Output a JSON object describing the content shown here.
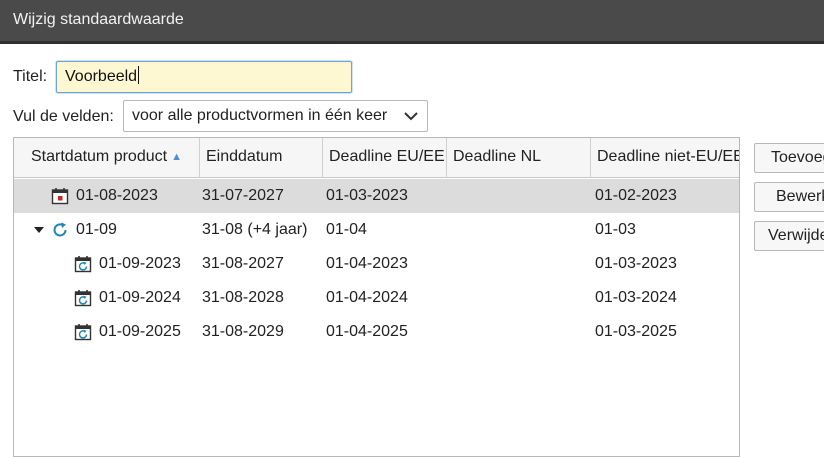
{
  "window": {
    "title": "Wijzig standaardwaarde"
  },
  "form": {
    "title_label": "Titel:",
    "title_value": "Voorbeeld",
    "fill_label": "Vul de velden:",
    "fill_value": "voor alle productvormen in één keer"
  },
  "table": {
    "columns": [
      "Startdatum product",
      "Einddatum",
      "Deadline EU/EE",
      "Deadline NL",
      "Deadline niet-EU/EE"
    ],
    "sorted_column": "Startdatum product",
    "sort_direction": "ascending",
    "rows": [
      {
        "start": "01-08-2023",
        "end": "31-07-2027",
        "eu": "01-03-2023",
        "nl": "",
        "noneu": "01-02-2023",
        "icon": "calendar-icon",
        "selected": true
      },
      {
        "start": "01-09",
        "end": "31-08 (+4 jaar)",
        "eu": "01-04",
        "nl": "",
        "noneu": "01-03",
        "icon": "recurring-icon",
        "expanded": true
      },
      {
        "start": "01-09-2023",
        "end": "31-08-2027",
        "eu": "01-04-2023",
        "nl": "",
        "noneu": "01-03-2023",
        "icon": "recurring-calendar-icon"
      },
      {
        "start": "01-09-2024",
        "end": "31-08-2028",
        "eu": "01-04-2024",
        "nl": "",
        "noneu": "01-03-2024",
        "icon": "recurring-calendar-icon"
      },
      {
        "start": "01-09-2025",
        "end": "31-08-2029",
        "eu": "01-04-2025",
        "nl": "",
        "noneu": "01-03-2025",
        "icon": "recurring-calendar-icon"
      }
    ]
  },
  "buttons": {
    "add": "Toevoegen",
    "edit": "Bewerken",
    "delete": "Verwijderen"
  },
  "colors": {
    "accent": "#4a90d9",
    "input_bg": "#fdf8d2",
    "selected_row": "#dcdcdc",
    "calendar_mark": "#c62828"
  }
}
